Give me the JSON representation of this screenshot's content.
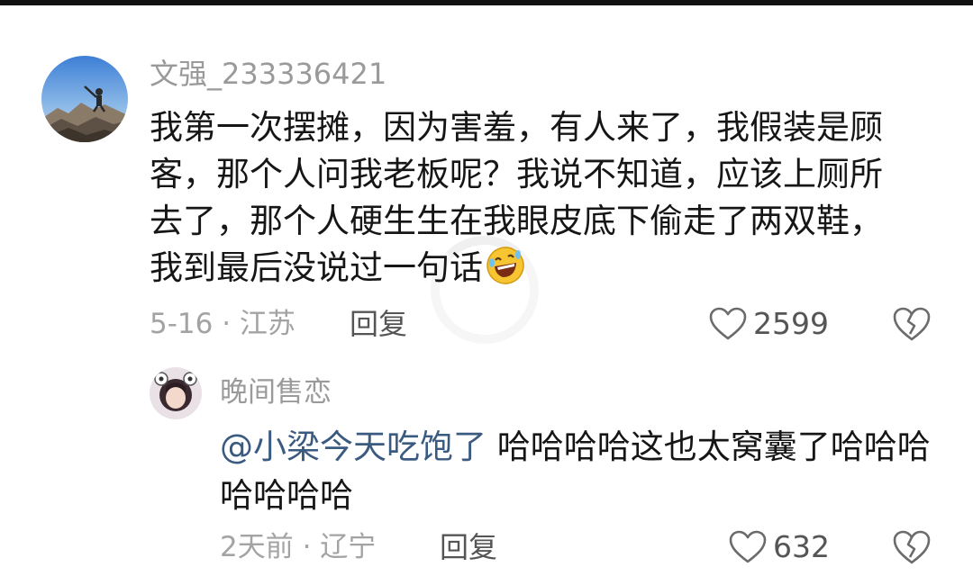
{
  "main_comment": {
    "username": "文强_233336421",
    "text": "我第一次摆摊，因为害羞，有人来了，我假装是顾客，那个人问我老板呢？我说不知道，应该上厕所去了，那个人硬生生在我眼皮底下偷走了两双鞋，我到最后没说过一句话",
    "emoji": "laughing-emoji-icon",
    "date_location": "5-16 · 江苏",
    "reply_label": "回复",
    "likes": "2599"
  },
  "reply_comment": {
    "username": "晚间售恋",
    "mention": "@小梁今天吃饱了",
    "text": " 哈哈哈哈这也太窝囊了哈哈哈哈哈哈哈",
    "date_location": "2天前 · 辽宁",
    "reply_label": "回复",
    "likes": "632"
  },
  "icons": {
    "like": "heart-outline-icon",
    "dislike": "broken-heart-icon"
  },
  "colors": {
    "text": "#161616",
    "meta": "#a3a3a3",
    "mention": "#3b5a80",
    "action": "#555555"
  }
}
